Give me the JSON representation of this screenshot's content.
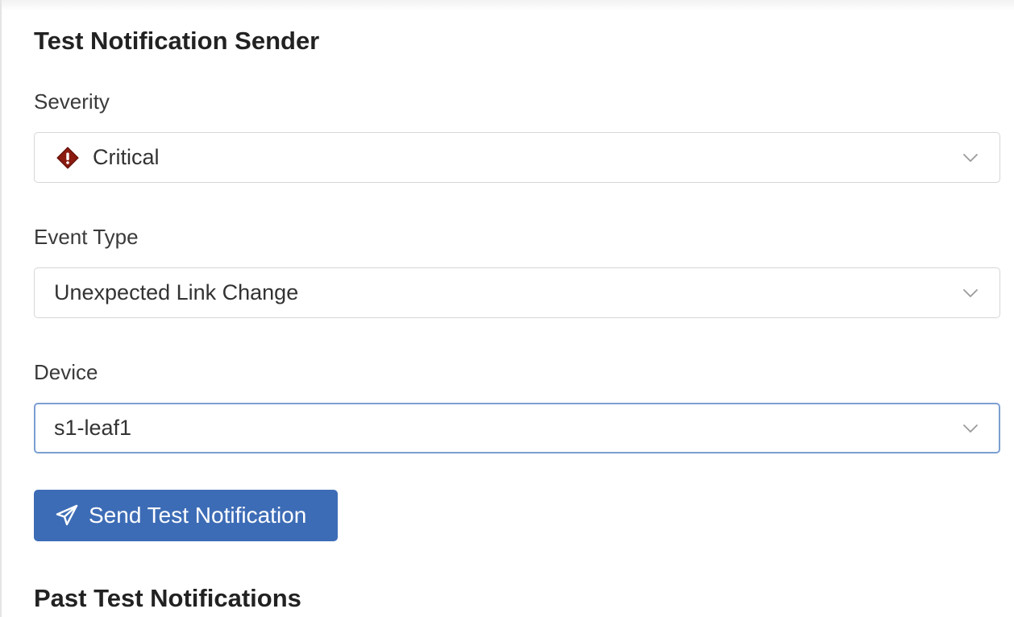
{
  "sender": {
    "title": "Test Notification Sender",
    "severity": {
      "label": "Severity",
      "value": "Critical",
      "icon": "critical-diamond-icon",
      "icon_color": "#8b1a10"
    },
    "event_type": {
      "label": "Event Type",
      "value": "Unexpected Link Change"
    },
    "device": {
      "label": "Device",
      "value": "s1-leaf1"
    },
    "send_button": {
      "label": "Send Test Notification",
      "icon": "paper-plane-icon",
      "color": "#3d6cb6"
    }
  },
  "history": {
    "title": "Past Test Notifications"
  },
  "colors": {
    "focus_border": "#7b9fd1",
    "border": "#d6d6d6"
  }
}
